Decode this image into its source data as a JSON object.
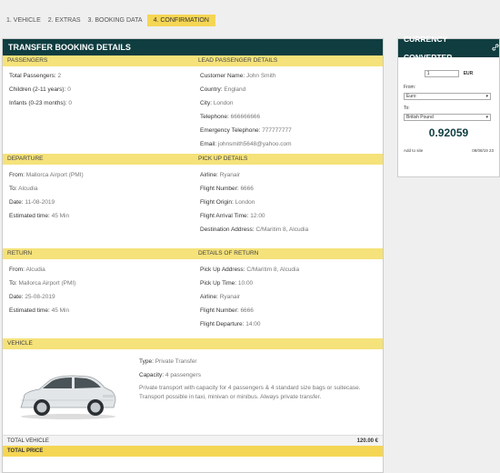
{
  "steps": [
    "1. VEHICLE",
    "2. EXTRAS",
    "3. BOOKING DATA",
    "4. CONFIRMATION"
  ],
  "panel_title": "TRANSFER BOOKING DETAILS",
  "passengers": {
    "left_head": "PASSENGERS",
    "right_head": "LEAD PASSENGER DETAILS",
    "left": [
      {
        "label": "Total Passengers:",
        "value": "2"
      },
      {
        "label": "Children (2-11 years):",
        "value": "0"
      },
      {
        "label": "Infants (0-23 months):",
        "value": "0"
      }
    ],
    "right": [
      {
        "label": "Customer Name:",
        "value": "John Smith"
      },
      {
        "label": "Country:",
        "value": "England"
      },
      {
        "label": "City:",
        "value": "London"
      },
      {
        "label": "Telephone:",
        "value": "666666666"
      },
      {
        "label": "Emergency Telephone:",
        "value": "777777777"
      },
      {
        "label": "Email:",
        "value": "johnsmith5648@yahoo.com"
      }
    ]
  },
  "departure": {
    "left_head": "DEPARTURE",
    "right_head": "PICK UP DETAILS",
    "left": [
      {
        "label": "From:",
        "value": "Mallorca Airport (PMI)"
      },
      {
        "label": "To:",
        "value": "Alcudia"
      },
      {
        "label": "Date:",
        "value": "11-08-2019"
      },
      {
        "label": "Estimated time:",
        "value": "45 Min"
      }
    ],
    "right": [
      {
        "label": "Airline:",
        "value": "Ryanair"
      },
      {
        "label": "Flight Number:",
        "value": "6666"
      },
      {
        "label": "Flight Origin:",
        "value": "London"
      },
      {
        "label": "Flight Arrival Time:",
        "value": "12:00"
      },
      {
        "label": "Destination Address:",
        "value": "C/Maritim 8, Alcudia"
      }
    ]
  },
  "return": {
    "left_head": "RETURN",
    "right_head": "DETAILS OF RETURN",
    "left": [
      {
        "label": "From:",
        "value": "Alcudia"
      },
      {
        "label": "To:",
        "value": "Mallorca Airport (PMI)"
      },
      {
        "label": "Date:",
        "value": "25-08-2019"
      },
      {
        "label": "Estimated time:",
        "value": "45 Min"
      }
    ],
    "right": [
      {
        "label": "Pick Up Address:",
        "value": "C/Maritim 8, Alcudia"
      },
      {
        "label": "Pick Up Time:",
        "value": "10:00"
      },
      {
        "label": "Airline:",
        "value": "Ryanair"
      },
      {
        "label": "Flight Number:",
        "value": "6666"
      },
      {
        "label": "Flight Departure:",
        "value": "14:00"
      }
    ]
  },
  "vehicle": {
    "head": "VEHICLE",
    "type_label": "Type:",
    "type_value": "Private Transfer",
    "capacity_label": "Capacity:",
    "capacity_value": "4 passengers",
    "description": "Private transport with capacity for 4 passengers & 4 standard size bags or suitecase. Transport possible in taxi, minivan or minibus. Always private transfer.",
    "total_label": "TOTAL VEHICLE",
    "total_value": "120.00 €",
    "total_price_label": "TOTAL PRICE"
  },
  "currency": {
    "title": "CURRENCY CONVERTER",
    "amount": "1",
    "amount_currency": "EUR",
    "from_label": "From:",
    "from_value": "Euro",
    "to_label": "To:",
    "to_value": "British Pound",
    "result": "0.92059",
    "add_label": "Add to site",
    "timestamp": "08/08/19 23"
  },
  "colors": {
    "accent": "#0f3d40",
    "highlight": "#f5d654",
    "section": "#f5e27a"
  }
}
